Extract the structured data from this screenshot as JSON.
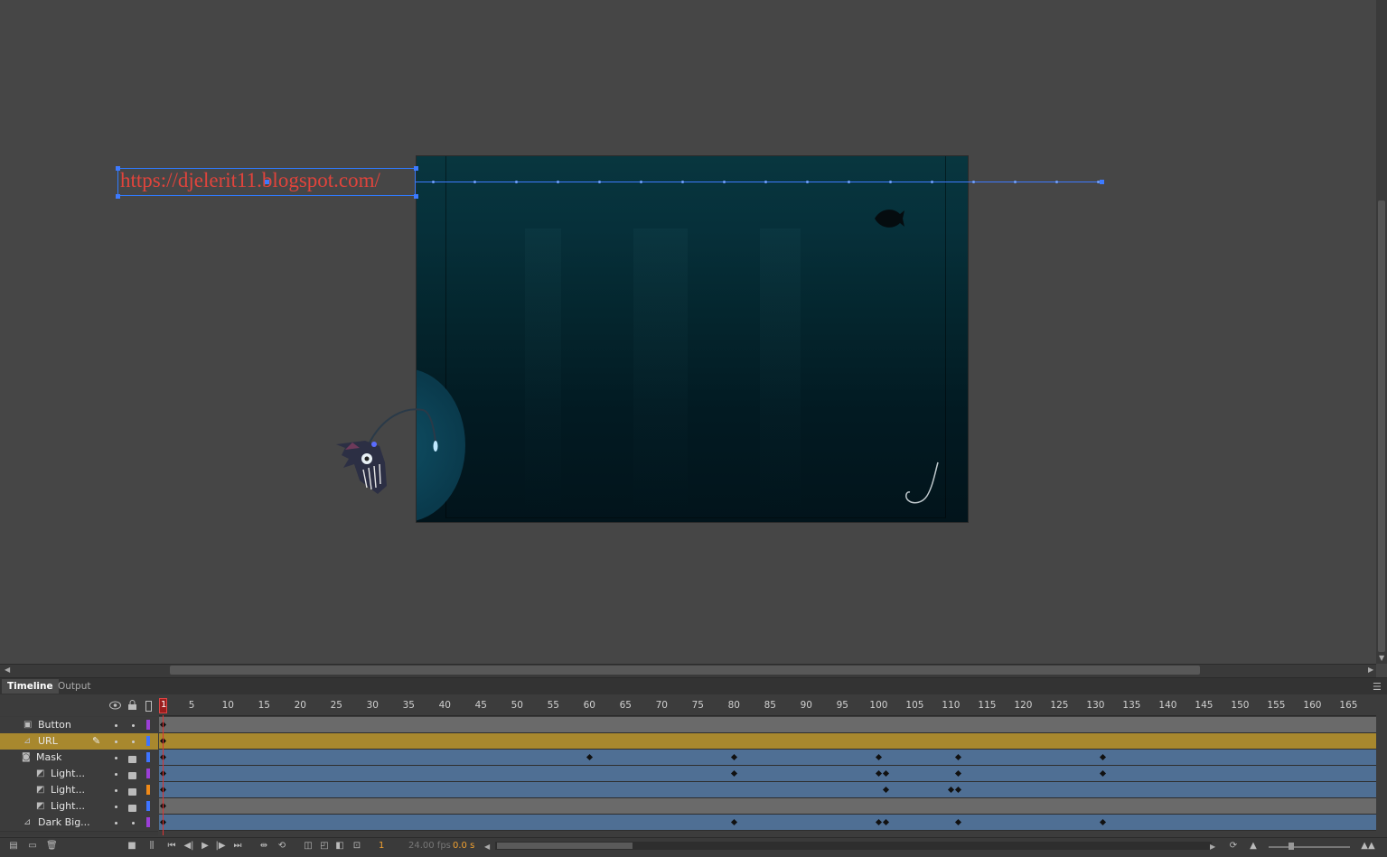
{
  "url_text": "https://djelerit11.blogspot.com/",
  "tabs": {
    "timeline": "Timeline",
    "output": "Output"
  },
  "ruler": {
    "current": "1",
    "labels": [
      "5",
      "10",
      "15",
      "20",
      "25",
      "30",
      "35",
      "40",
      "45",
      "50",
      "55",
      "60",
      "65",
      "70",
      "75",
      "80",
      "85",
      "90",
      "95",
      "100",
      "105",
      "110",
      "115",
      "120",
      "125",
      "130",
      "135",
      "140",
      "145",
      "150",
      "155",
      "160",
      "165"
    ]
  },
  "layers": [
    {
      "name": "Button",
      "type": "normal",
      "color": "#9b3fd6",
      "locked": false,
      "selected": false,
      "keyframes": []
    },
    {
      "name": "URL",
      "type": "guide",
      "color": "#3e74ff",
      "locked": false,
      "selected": true,
      "keyframes": []
    },
    {
      "name": "Mask",
      "type": "mask",
      "color": "#3e74ff",
      "locked": true,
      "selected": false,
      "keyframes": [
        60,
        80,
        100,
        111,
        131
      ]
    },
    {
      "name": "Light...",
      "type": "masked",
      "color": "#9b3fd6",
      "locked": true,
      "selected": false,
      "keyframes": [
        80,
        100,
        101,
        111,
        131
      ]
    },
    {
      "name": "Light...",
      "type": "masked",
      "color": "#f08a18",
      "locked": true,
      "selected": false,
      "keyframes": [
        101,
        110,
        111
      ]
    },
    {
      "name": "Light...",
      "type": "masked",
      "color": "#3e74ff",
      "locked": true,
      "selected": false,
      "keyframes": []
    },
    {
      "name": "Dark Big...",
      "type": "guide",
      "color": "#9b3fd6",
      "locked": false,
      "selected": false,
      "keyframes": [
        80,
        100,
        101,
        111,
        131
      ]
    }
  ],
  "status": {
    "frame": "1",
    "fps": "24.00 fps",
    "time": "0.0 s"
  },
  "colors": {
    "accent": "#3d7aff",
    "url_text": "#e0443c",
    "selected_layer": "#a8882e",
    "tween_span": "#4f6f94"
  },
  "icons": [
    "eye-icon",
    "lock-icon",
    "outline-icon",
    "pencil-icon",
    "new-layer-icon",
    "new-folder-icon",
    "trash-icon",
    "play-icon",
    "loop-icon",
    "onion-skin-icon"
  ]
}
